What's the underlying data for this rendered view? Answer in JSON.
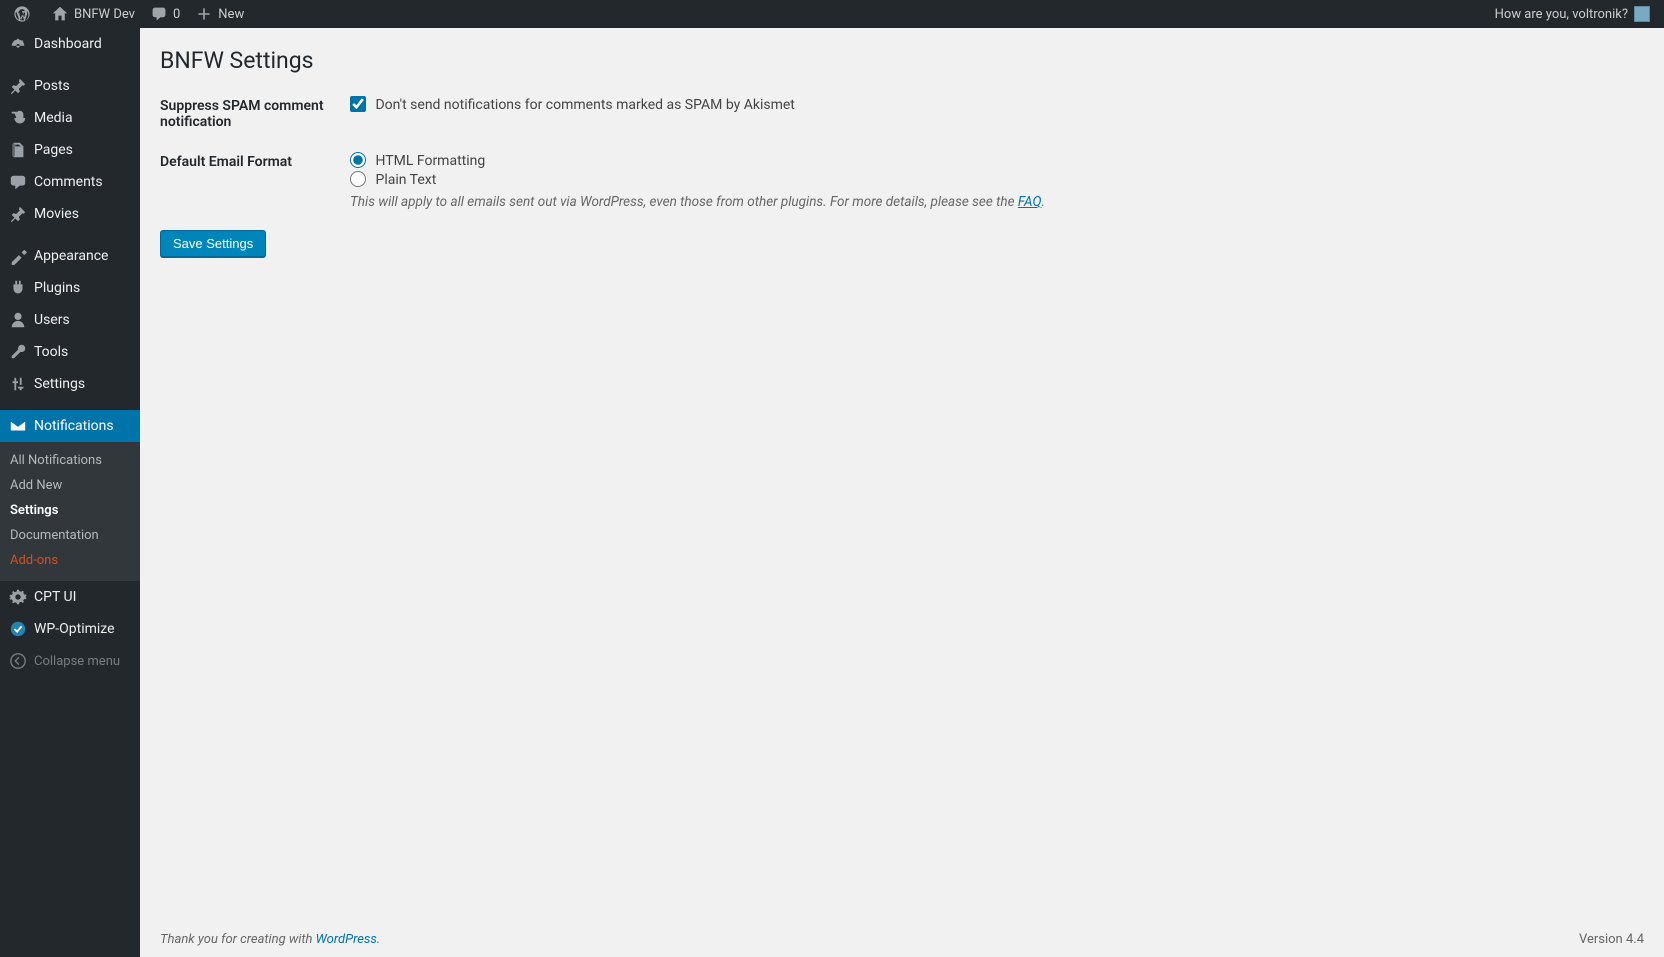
{
  "adminbar": {
    "site_name": "BNFW Dev",
    "comments_count": "0",
    "new_label": "New",
    "greeting": "How are you, voltronik?"
  },
  "sidebar": {
    "items": [
      {
        "label": "Dashboard",
        "icon": "dashboard"
      },
      {
        "label": "Posts",
        "icon": "pin"
      },
      {
        "label": "Media",
        "icon": "media"
      },
      {
        "label": "Pages",
        "icon": "pages"
      },
      {
        "label": "Comments",
        "icon": "comment"
      },
      {
        "label": "Movies",
        "icon": "pin"
      },
      {
        "label": "Appearance",
        "icon": "appearance"
      },
      {
        "label": "Plugins",
        "icon": "plugin"
      },
      {
        "label": "Users",
        "icon": "user"
      },
      {
        "label": "Tools",
        "icon": "tools"
      },
      {
        "label": "Settings",
        "icon": "settings"
      },
      {
        "label": "Notifications",
        "icon": "mail"
      },
      {
        "label": "CPT UI",
        "icon": "gear"
      },
      {
        "label": "WP-Optimize",
        "icon": "check"
      }
    ],
    "submenu": {
      "items": [
        "All Notifications",
        "Add New",
        "Settings",
        "Documentation",
        "Add-ons"
      ]
    },
    "collapse_label": "Collapse menu"
  },
  "page": {
    "title": "BNFW Settings",
    "rows": {
      "spam": {
        "heading": "Suppress SPAM comment notification",
        "checkbox_label": "Don't send notifications for comments marked as SPAM by Akismet"
      },
      "format": {
        "heading": "Default Email Format",
        "option_html": "HTML Formatting",
        "option_plain": "Plain Text",
        "desc_pre": "This will apply to all emails sent out via WordPress, even those from other plugins. For more details, please see the ",
        "desc_link": "FAQ",
        "desc_post": "."
      }
    },
    "save_button": "Save Settings"
  },
  "footer": {
    "thanks_pre": "Thank you for creating with ",
    "thanks_link": "WordPress",
    "thanks_post": ".",
    "version": "Version 4.4"
  }
}
